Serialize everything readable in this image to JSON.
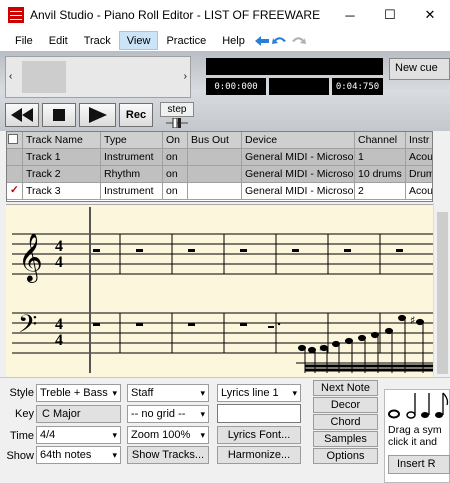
{
  "window": {
    "title": "Anvil Studio - Piano Roll Editor - LIST OF FREEWARE",
    "minimize": "─",
    "maximize": "☐",
    "close": "✕"
  },
  "menu": {
    "items": [
      "File",
      "Edit",
      "Track",
      "View",
      "Practice",
      "Help"
    ],
    "active": "View"
  },
  "toolbar": {
    "time_start": "0:00:000",
    "time_end": "0:04:750",
    "new_cue_label": "New cue",
    "rec_label": "Rec",
    "step_label": "step"
  },
  "track_table": {
    "columns": [
      "Track Name",
      "Type",
      "On",
      "Bus Out",
      "Device",
      "Channel",
      "Instr"
    ],
    "rows": [
      {
        "check": "",
        "name": "Track 1",
        "type": "Instrument",
        "on": "on",
        "bus_out": "",
        "device": "General MIDI - Microso",
        "channel": "1",
        "instr": "Acou"
      },
      {
        "check": "",
        "name": "Track 2",
        "type": "Rhythm",
        "on": "on",
        "bus_out": "",
        "device": "General MIDI - Microso",
        "channel": "10 drums",
        "instr": "Drum"
      },
      {
        "check": "✓",
        "name": "Track 3",
        "type": "Instrument",
        "on": "on",
        "bus_out": "",
        "device": "General MIDI - Microso",
        "channel": "2",
        "instr": "Acou"
      }
    ]
  },
  "score": {
    "time_signature_top": "4",
    "time_signature_bottom": "4"
  },
  "panel": {
    "style_label": "Style",
    "style_value": "Treble + Bass",
    "key_label": "Key",
    "key_value": "C Major",
    "time_label": "Time",
    "time_value": "4/4",
    "show_label": "Show",
    "show_value": "64th notes",
    "staff_value": "Staff",
    "grid_value": "-- no grid --",
    "zoom_value": "Zoom 100%",
    "show_tracks_label": "Show Tracks...",
    "lyrics_line_value": "Lyrics line 1",
    "lyrics_input_value": "",
    "lyrics_font_label": "Lyrics Font...",
    "harmonize_label": "Harmonize...",
    "next_note_label": "Next Note",
    "decor_label": "Decor",
    "chord_label": "Chord",
    "samples_label": "Samples",
    "options_label": "Options",
    "drag_line1": "Drag a sym",
    "drag_line2": "click it and",
    "insert_label": "Insert R"
  }
}
